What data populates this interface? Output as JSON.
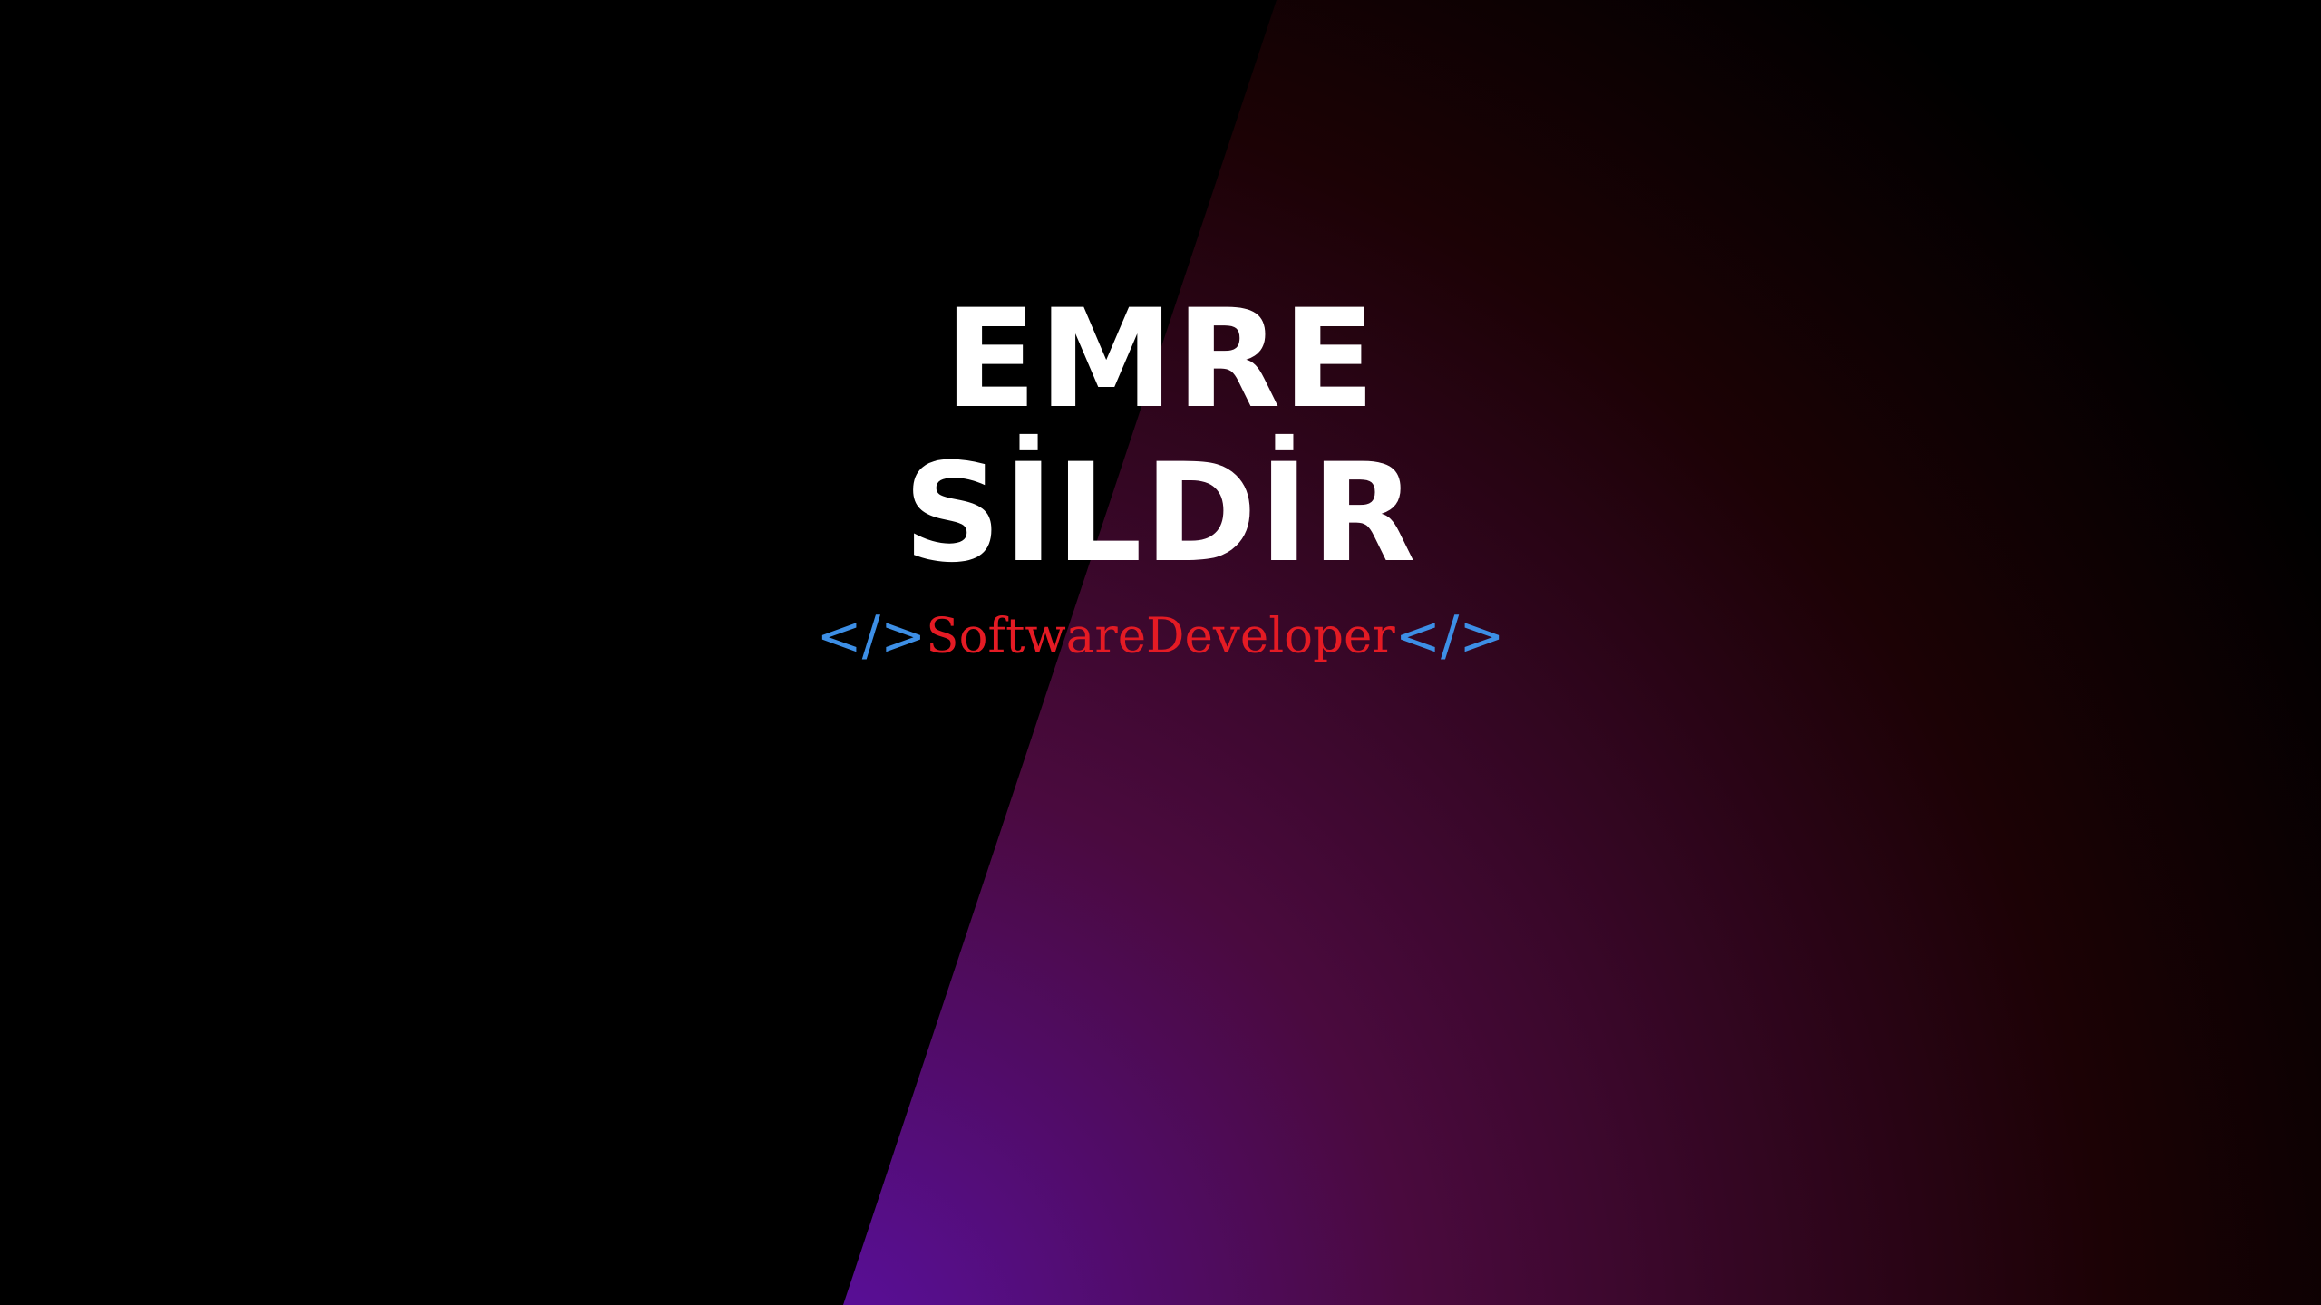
{
  "name": {
    "line1": "EMRE",
    "line2": "SİLDİR"
  },
  "tagline": {
    "open_tag": "</>",
    "role": "SoftwareDeveloper",
    "close_tag": "</>"
  },
  "colors": {
    "background": "#000000",
    "gradient_purple": "#5a0fa0",
    "gradient_magenta": "#4a0a3e",
    "gradient_dark_red": "#1c0205",
    "name_text": "#ffffff",
    "code_tag": "#3d8fe6",
    "role_text": "#e41b24"
  }
}
